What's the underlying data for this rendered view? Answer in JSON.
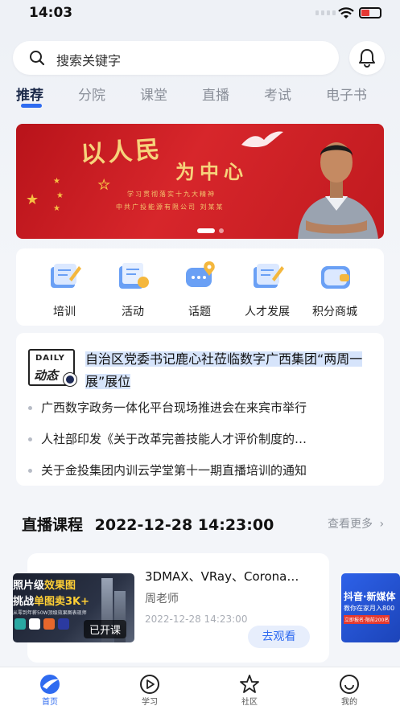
{
  "status": {
    "time": "14:03"
  },
  "search": {
    "placeholder": "搜索关键字"
  },
  "tabs": [
    {
      "label": "推荐",
      "active": true
    },
    {
      "label": "分院"
    },
    {
      "label": "课堂"
    },
    {
      "label": "直播"
    },
    {
      "label": "考试"
    },
    {
      "label": "电子书"
    }
  ],
  "banner": {
    "headline1": "以人民",
    "headline2": "为中心",
    "line1": "学习贯彻落实十九大精神",
    "line2": "中共广投能源有限公司 刘某某",
    "page_index": 1,
    "page_count": 2
  },
  "menu": [
    {
      "label": "培训",
      "icon": "training-icon"
    },
    {
      "label": "活动",
      "icon": "activity-icon"
    },
    {
      "label": "话题",
      "icon": "topic-icon"
    },
    {
      "label": "人才发展",
      "icon": "talent-icon"
    },
    {
      "label": "积分商城",
      "icon": "points-mall-icon"
    }
  ],
  "news": {
    "badge_line1": "DAILY",
    "badge_line2": "动态",
    "headline": "自治区党委书记鹿心社莅临数字广西集团“两周一展”展位",
    "items": [
      "广西数字政务一体化平台现场推进会在来宾市举行",
      "人社部印发《关于改革完善技能人才评价制度的…",
      "关于金投集团内训云学堂第十一期直播培训的通知"
    ]
  },
  "live": {
    "section_title": "直播课程",
    "datetime": "2022-12-28 14:23:00",
    "more_label": "查看更多",
    "course": {
      "thumb_line1_a": "照片级",
      "thumb_line1_b": "效果图",
      "thumb_line2_a": "挑战",
      "thumb_line2_b": "单图卖3K+",
      "thumb_line3": "从零到年薪50W顶级效果图表现师",
      "status_badge": "已开课",
      "title": "3DMAX、VRay、Corona…",
      "teacher": "周老师",
      "time": "2022-12-28 14:23:00",
      "watch_label": "去观看"
    },
    "next_card": {
      "line1": "抖音·新媒体",
      "line2": "教你在家月入800",
      "line3": "立即报名·限前200名"
    }
  },
  "tabbar": [
    {
      "label": "首页",
      "icon": "home-icon",
      "active": true
    },
    {
      "label": "学习",
      "icon": "play-icon"
    },
    {
      "label": "社区",
      "icon": "star-icon"
    },
    {
      "label": "我的",
      "icon": "smile-icon"
    }
  ],
  "colors": {
    "accent": "#2f6bf0",
    "banner_red": "#d7262b",
    "gold": "#f6d37b"
  }
}
